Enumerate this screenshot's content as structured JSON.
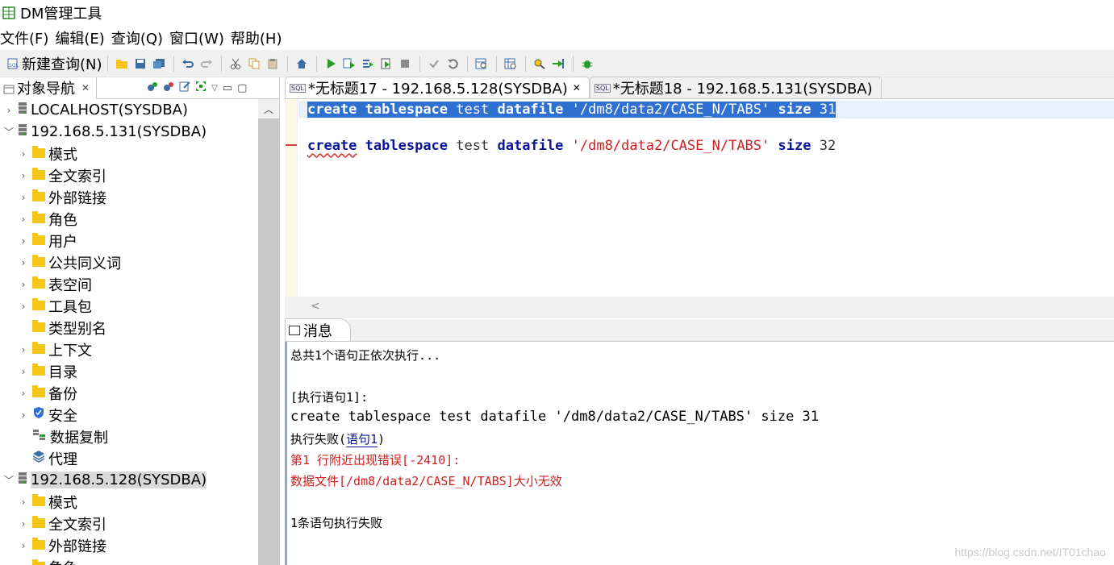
{
  "window": {
    "title": "DM管理工具"
  },
  "menu": [
    {
      "label": "文件(F)"
    },
    {
      "label": "编辑(E)"
    },
    {
      "label": "查询(Q)"
    },
    {
      "label": "窗口(W)"
    },
    {
      "label": "帮助(H)"
    }
  ],
  "toolbar": {
    "new_query_label": "新建查询(N)"
  },
  "navigator": {
    "tab_label": "对象导航",
    "tree": [
      {
        "label": "LOCALHOST(SYSDBA)",
        "level": 0,
        "expanded": false,
        "icon": "server-icon"
      },
      {
        "label": "192.168.5.131(SYSDBA)",
        "level": 0,
        "expanded": true,
        "icon": "server-icon"
      },
      {
        "label": "模式",
        "level": 1,
        "icon": "folder-icon"
      },
      {
        "label": "全文索引",
        "level": 1,
        "icon": "folder-icon"
      },
      {
        "label": "外部链接",
        "level": 1,
        "icon": "folder-icon"
      },
      {
        "label": "角色",
        "level": 1,
        "icon": "folder-icon"
      },
      {
        "label": "用户",
        "level": 1,
        "icon": "folder-icon"
      },
      {
        "label": "公共同义词",
        "level": 1,
        "icon": "folder-icon"
      },
      {
        "label": "表空间",
        "level": 1,
        "icon": "folder-icon"
      },
      {
        "label": "工具包",
        "level": 1,
        "icon": "folder-icon"
      },
      {
        "label": "类型别名",
        "level": 1,
        "icon": "folder-icon",
        "leaf": true
      },
      {
        "label": "上下文",
        "level": 1,
        "icon": "folder-icon"
      },
      {
        "label": "目录",
        "level": 1,
        "icon": "folder-icon"
      },
      {
        "label": "备份",
        "level": 1,
        "icon": "folder-icon"
      },
      {
        "label": "安全",
        "level": 1,
        "icon": "shield-icon"
      },
      {
        "label": "数据复制",
        "level": 1,
        "icon": "replication-icon",
        "leaf": true
      },
      {
        "label": "代理",
        "level": 1,
        "icon": "layers-icon",
        "leaf": true
      },
      {
        "label": "192.168.5.128(SYSDBA)",
        "level": 0,
        "expanded": true,
        "icon": "server-icon",
        "selected": true
      },
      {
        "label": "模式",
        "level": 1,
        "icon": "folder-icon"
      },
      {
        "label": "全文索引",
        "level": 1,
        "icon": "folder-icon"
      },
      {
        "label": "外部链接",
        "level": 1,
        "icon": "folder-icon"
      },
      {
        "label": "角色",
        "level": 1,
        "icon": "folder-icon"
      }
    ]
  },
  "editor": {
    "tabs": [
      {
        "label": "*无标题17 - 192.168.5.128(SYSDBA)",
        "active": true
      },
      {
        "label": "*无标题18 - 192.168.5.131(SYSDBA)",
        "active": false
      }
    ],
    "lines": [
      {
        "kw1": "create",
        "kw2": "tablespace",
        "name": "test",
        "kw3": "datafile",
        "path": "'/dm8/data2/CASE_N/TABS'",
        "kw4": "size",
        "num": "31"
      },
      {
        "kw1": "create",
        "kw2": "tablespace",
        "name": "test",
        "kw3": "datafile",
        "path": "'/dm8/data2/CASE_N/TABS'",
        "kw4": "size",
        "num": "32"
      }
    ]
  },
  "messages": {
    "tab_label": "消息",
    "line1": "总共1个语句正依次执行...",
    "line2": "[执行语句1]:",
    "line3": "create tablespace test datafile '/dm8/data2/CASE_N/TABS' size 31",
    "line4_prefix": "执行失败(",
    "line4_link": "语句1",
    "line4_suffix": ")",
    "line5": "第1 行附近出现错误[-2410]:",
    "line6": "数据文件[/dm8/data2/CASE_N/TABS]大小无效",
    "line7": "1条语句执行失败",
    "watermark": "https://blog.csdn.net/IT01chao"
  }
}
